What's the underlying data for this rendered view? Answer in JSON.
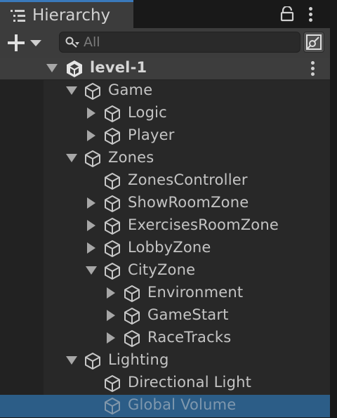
{
  "window": {
    "tab_title": "Hierarchy",
    "tab_icon": "hierarchy-list-icon",
    "lock_icon": "lock-icon",
    "menu_icon": "kebab-menu-icon"
  },
  "toolbar": {
    "add_icon": "plus-icon",
    "dropdown_icon": "chevron-down-icon",
    "search_placeholder": "All",
    "search_icon": "search-icon",
    "scene_search_icon": "open-scene-search-icon"
  },
  "colors": {
    "accent": "#3a79bb",
    "selection": "#2c5d87",
    "panel": "#282828"
  },
  "scene": {
    "name": "level-1",
    "icon": "unity-logo-icon",
    "menu_icon": "kebab-menu-icon"
  },
  "tree": [
    {
      "label": "Game",
      "depth": 1,
      "expander": "expanded"
    },
    {
      "label": "Logic",
      "depth": 2,
      "expander": "collapsed"
    },
    {
      "label": "Player",
      "depth": 2,
      "expander": "collapsed"
    },
    {
      "label": "Zones",
      "depth": 1,
      "expander": "expanded"
    },
    {
      "label": "ZonesController",
      "depth": 2,
      "expander": "none"
    },
    {
      "label": "ShowRoomZone",
      "depth": 2,
      "expander": "collapsed"
    },
    {
      "label": "ExercisesRoomZone",
      "depth": 2,
      "expander": "collapsed"
    },
    {
      "label": "LobbyZone",
      "depth": 2,
      "expander": "collapsed"
    },
    {
      "label": "CityZone",
      "depth": 2,
      "expander": "expanded"
    },
    {
      "label": "Environment",
      "depth": 3,
      "expander": "collapsed"
    },
    {
      "label": "GameStart",
      "depth": 3,
      "expander": "collapsed"
    },
    {
      "label": "RaceTracks",
      "depth": 3,
      "expander": "collapsed"
    },
    {
      "label": "Lighting",
      "depth": 1,
      "expander": "expanded"
    },
    {
      "label": "Directional Light",
      "depth": 2,
      "expander": "none"
    },
    {
      "label": "Global Volume",
      "depth": 2,
      "expander": "none",
      "selected": true
    }
  ]
}
